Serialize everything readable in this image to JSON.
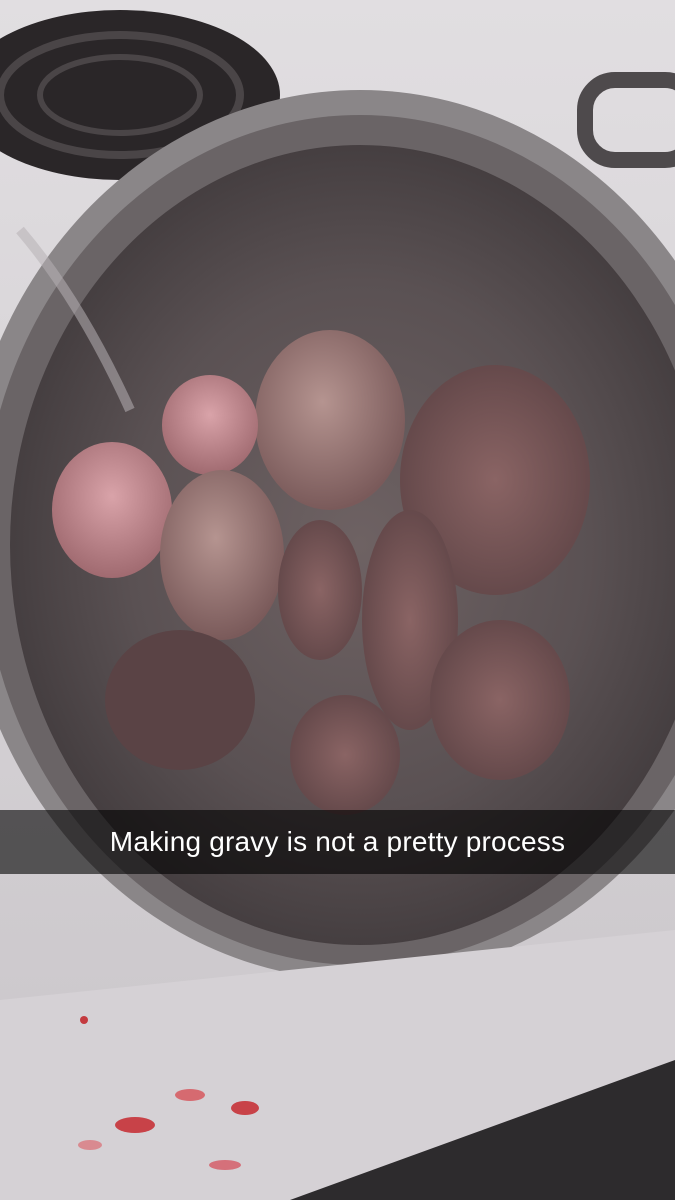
{
  "snap": {
    "caption": "Making gravy is not a pretty process"
  },
  "photo": {
    "subject_icon": "pot-of-meat-photo",
    "colors": {
      "stovetop": "#e3e0e3",
      "pot_rim": "#8a8688",
      "pot_inside": "#5a5153",
      "meat": "#8e6a6a",
      "caption_bar": "#000000"
    }
  }
}
